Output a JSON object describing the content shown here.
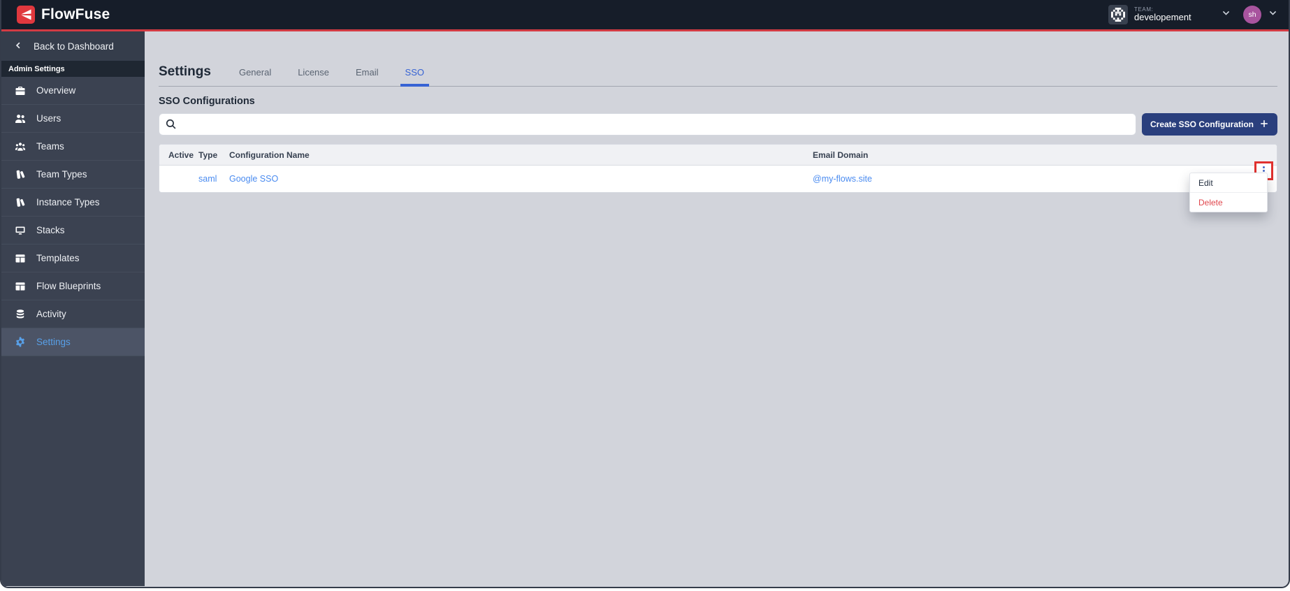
{
  "navbar": {
    "logo_text": "FlowFuse",
    "team": {
      "label": "TEAM:",
      "name": "developement"
    },
    "user_initials": "sh"
  },
  "sidebar": {
    "back_label": "Back to Dashboard",
    "section_label": "Admin Settings",
    "items": [
      {
        "label": "Overview",
        "icon": "briefcase-icon",
        "active": false
      },
      {
        "label": "Users",
        "icon": "users-icon",
        "active": false
      },
      {
        "label": "Teams",
        "icon": "user-group-icon",
        "active": false
      },
      {
        "label": "Team Types",
        "icon": "versions-icon",
        "active": false
      },
      {
        "label": "Instance Types",
        "icon": "versions-icon",
        "active": false
      },
      {
        "label": "Stacks",
        "icon": "monitor-icon",
        "active": false
      },
      {
        "label": "Templates",
        "icon": "table-icon",
        "active": false
      },
      {
        "label": "Flow Blueprints",
        "icon": "table-icon",
        "active": false
      },
      {
        "label": "Activity",
        "icon": "database-icon",
        "active": false
      },
      {
        "label": "Settings",
        "icon": "gear-icon",
        "active": true
      }
    ]
  },
  "main": {
    "title": "Settings",
    "tabs": [
      {
        "label": "General",
        "active": false
      },
      {
        "label": "License",
        "active": false
      },
      {
        "label": "Email",
        "active": false
      },
      {
        "label": "SSO",
        "active": true
      }
    ],
    "section_title": "SSO Configurations",
    "search": {
      "placeholder": "",
      "value": ""
    },
    "create_button_label": "Create SSO Configuration",
    "table": {
      "headers": [
        "Active",
        "Type",
        "Configuration Name",
        "Email Domain"
      ],
      "rows": [
        {
          "active": "",
          "type": "saml",
          "name": "Google SSO",
          "email_domain": "@my-flows.site"
        }
      ]
    },
    "context_menu": {
      "items": [
        {
          "label": "Edit",
          "danger": false
        },
        {
          "label": "Delete",
          "danger": true
        }
      ]
    }
  },
  "colors": {
    "accent_red": "#d23b43",
    "brand_red": "#e0383e",
    "link_blue": "#4a8bf0",
    "tab_active_blue": "#3763d4",
    "button_bg": "#2a3f7d",
    "sidebar_active_blue": "#58a0e8",
    "delete_red": "#e0474d",
    "highlight_box_red": "#e0312f",
    "navbar_bg": "#161d29",
    "sidebar_bg": "#3b4251",
    "main_bg": "#d2d4db"
  }
}
